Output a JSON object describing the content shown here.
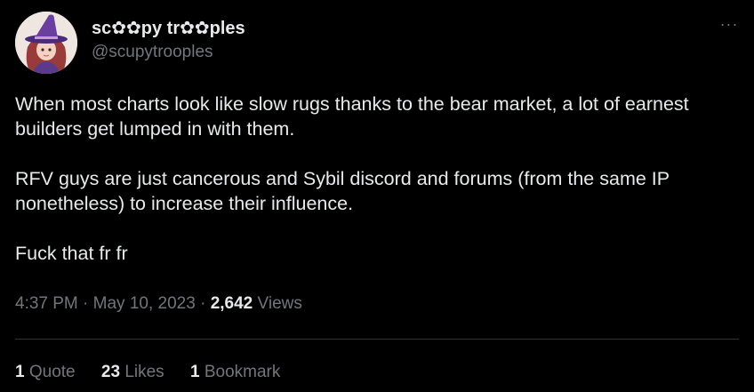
{
  "author": {
    "display_name": "sc✿✿py tr✿✿ples",
    "handle": "@scupytrooples"
  },
  "more_icon": "more-horizontal-icon",
  "tweet": {
    "paragraphs": [
      "When most charts look like slow rugs thanks to the bear market, a lot of earnest builders get lumped in with them.",
      "RFV guys are just cancerous and Sybil discord and forums (from the same IP nonetheless) to increase their influence.",
      "Fuck that fr fr"
    ]
  },
  "meta": {
    "time": "4:37 PM",
    "separator": "·",
    "date": "May 10, 2023",
    "views_count": "2,642",
    "views_label": "Views"
  },
  "stats": {
    "quotes_count": "1",
    "quotes_label": "Quote",
    "likes_count": "23",
    "likes_label": "Likes",
    "bookmarks_count": "1",
    "bookmarks_label": "Bookmark"
  },
  "colors": {
    "background": "#000000",
    "text_primary": "#e7e9ea",
    "text_secondary": "#71767b",
    "divider": "#2f3336"
  }
}
